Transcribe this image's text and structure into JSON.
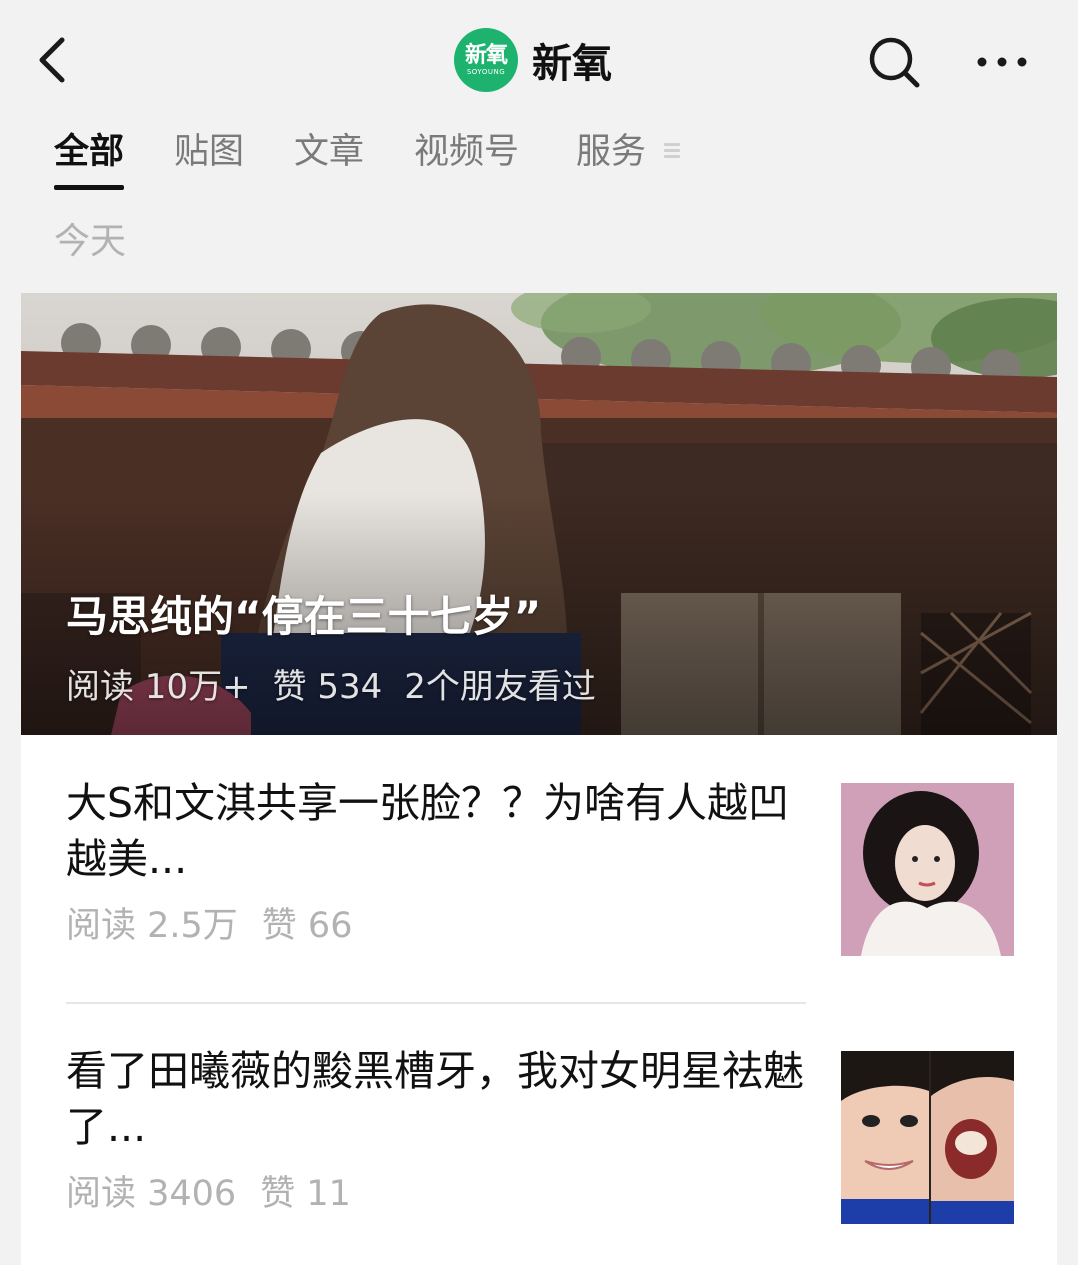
{
  "nav": {
    "logo_text": "新氧",
    "logo_subtext": "SOYOUNG",
    "title": "新氧"
  },
  "tabs": [
    {
      "label": "全部",
      "active": true
    },
    {
      "label": "贴图"
    },
    {
      "label": "文章"
    },
    {
      "label": "视频号"
    },
    {
      "label": "服务"
    }
  ],
  "date_label": "今天",
  "featured": {
    "title": "马思纯的“停在三十七岁”",
    "reads": "阅读 10万+",
    "likes": "赞 534",
    "friends": "2个朋友看过"
  },
  "articles": [
    {
      "title": "大S和文淇共享一张脸？？为啥有人越凹越美...",
      "reads": "阅读 2.5万",
      "likes": "赞 66"
    },
    {
      "title": "看了田曦薇的黢黑槽牙，我对女明星祛魅了...",
      "reads": "阅读 3406",
      "likes": "赞 11"
    }
  ],
  "colors": {
    "brand_green": "#1db36f",
    "background": "#f2f2f2",
    "muted_text": "#b2b2b2"
  }
}
